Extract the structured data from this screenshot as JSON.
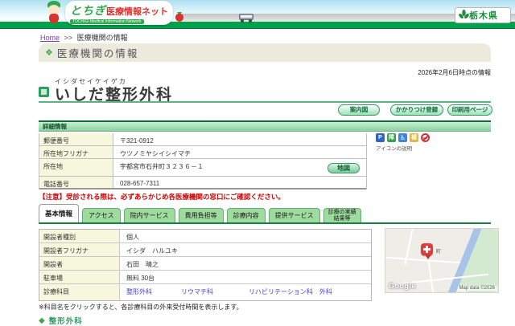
{
  "header": {
    "logo_title_main": "とちぎ",
    "logo_title_rest": "医療情報ネット",
    "logo_subtitle": "TOCHIGI Medical Information Network",
    "pref_name": "栃木県"
  },
  "breadcrumb": {
    "home": "Home",
    "sep": ">>",
    "current": "医療機関の情報"
  },
  "page": {
    "section_title": "医療機関の情報",
    "info_date": "2026年2月6日時点の情報",
    "notice": "【注意】受診される際は、必ずあらかじめ各医療機関の窓口にご確認ください。",
    "footnote": "※科目名をクリックすると、各診療科目の外来受付時間を表示します。",
    "bottom_heading": "整形外科"
  },
  "facility": {
    "furigana": "イシダセイケイゲカ",
    "name": "いしだ整形外科",
    "btn_guide_map": "案内図",
    "btn_family_doctor": "かかりつけ登録",
    "btn_print": "印刷用ページ"
  },
  "details": {
    "title": "詳細情報",
    "rows": [
      {
        "label": "郵便番号",
        "value": "〒321-0912"
      },
      {
        "label": "所在地フリガナ",
        "value": "ウツノミヤシイシイマチ"
      },
      {
        "label": "所在地",
        "value": "宇都宮市石井町３２３６－１"
      },
      {
        "label": "電話番号",
        "value": "028-657-7311"
      }
    ],
    "map_button": "地図",
    "icon_legend": "アイコンの説明",
    "icons": [
      {
        "name": "parking",
        "glyph": "P",
        "color": "#2e63c8"
      },
      {
        "name": "barrier-free",
        "glyph": "障",
        "color": "#37a24c"
      },
      {
        "name": "wheelchair",
        "glyph": "♿",
        "color": "#3e86d8"
      },
      {
        "name": "support",
        "glyph": "補",
        "color": "#e5b53c"
      },
      {
        "name": "no-smoking",
        "glyph": "",
        "color": "#d23333"
      }
    ]
  },
  "tabs": [
    {
      "label": "基本情報",
      "active": true
    },
    {
      "label": "アクセス"
    },
    {
      "label": "院内サービス"
    },
    {
      "label": "費用負担等"
    },
    {
      "label": "診療内容"
    },
    {
      "label": "提供サービス"
    },
    {
      "label": "診療の実績",
      "label2": "結果等"
    }
  ],
  "basic_info": {
    "rows": [
      {
        "label": "開設者種別",
        "value": "個人"
      },
      {
        "label": "開設者フリガナ",
        "value": "イシダ　ハルユキ"
      },
      {
        "label": "開設者",
        "value": "石田　晴之"
      },
      {
        "label": "駐車場",
        "value": "無料 30台"
      }
    ],
    "dept_label": "診療科目",
    "departments": [
      "整形外科",
      "リウマチ科",
      "リハビリテーション科",
      "外科"
    ]
  },
  "map": {
    "marker_label": "町",
    "watermark": "Google",
    "copyright": "Map data ©2026"
  },
  "colors": {
    "brand_green": "#00a14b",
    "accent_green": "#2e9e60",
    "link_blue": "#4040c8",
    "notice_red": "#d10000"
  }
}
